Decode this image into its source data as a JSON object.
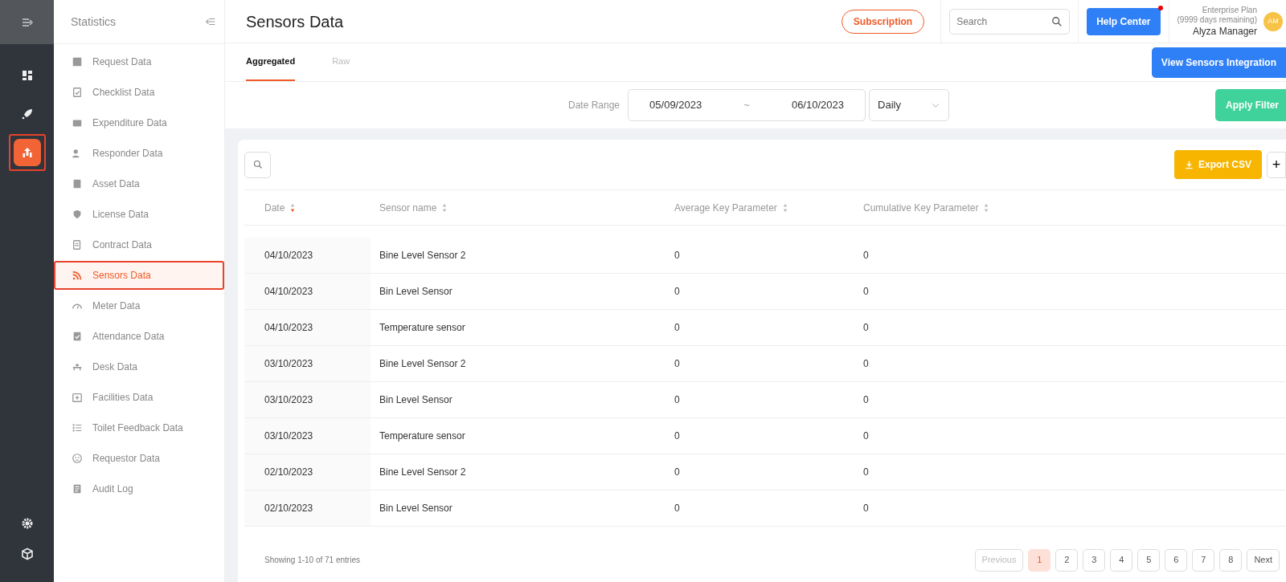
{
  "rail": {
    "items": [
      {
        "kind": "dashboard",
        "selected": false
      },
      {
        "kind": "rocket",
        "selected": false
      },
      {
        "kind": "statistics",
        "selected": true
      }
    ],
    "bottom_items": [
      {
        "kind": "settings"
      },
      {
        "kind": "box"
      }
    ]
  },
  "sidebar": {
    "title": "Statistics",
    "items": [
      {
        "label": "Request Data",
        "selected": false
      },
      {
        "label": "Checklist Data",
        "selected": false
      },
      {
        "label": "Expenditure Data",
        "selected": false
      },
      {
        "label": "Responder Data",
        "selected": false
      },
      {
        "label": "Asset Data",
        "selected": false
      },
      {
        "label": "License Data",
        "selected": false
      },
      {
        "label": "Contract Data",
        "selected": false
      },
      {
        "label": "Sensors Data",
        "selected": true
      },
      {
        "label": "Meter Data",
        "selected": false
      },
      {
        "label": "Attendance Data",
        "selected": false
      },
      {
        "label": "Desk Data",
        "selected": false
      },
      {
        "label": "Facilities Data",
        "selected": false
      },
      {
        "label": "Toilet Feedback Data",
        "selected": false
      },
      {
        "label": "Requestor Data",
        "selected": false
      },
      {
        "label": "Audit Log",
        "selected": false
      }
    ]
  },
  "header": {
    "title": "Sensors Data",
    "subscription": "Subscription",
    "search": {
      "placeholder": "Search"
    },
    "help": {
      "label": "Help Center",
      "notification": true
    },
    "plan": "Enterprise Plan",
    "plan_remaining": "(9999 days remaining)",
    "user": "Alyza Manager",
    "avatar": "AM"
  },
  "tabs": [
    {
      "label": "Aggregated",
      "selected": true
    },
    {
      "label": "Raw",
      "selected": false
    }
  ],
  "integration_button": "View Sensors Integration",
  "filter": {
    "label": "Date Range",
    "start": "05/09/2023",
    "separator": "~",
    "end": "06/10/2023",
    "period": "Daily",
    "apply": "Apply Filter"
  },
  "table": {
    "export": "Export CSV",
    "add": "+",
    "columns": [
      {
        "label": "Date",
        "sorted": true
      },
      {
        "label": "Sensor name",
        "sorted": false
      },
      {
        "label": "Average Key Parameter",
        "sorted": false
      },
      {
        "label": "Cumulative Key Parameter",
        "sorted": false
      }
    ],
    "rows": [
      [
        "04/10/2023",
        "Bine Level Sensor 2",
        "0",
        "0"
      ],
      [
        "04/10/2023",
        "Bin Level Sensor",
        "0",
        "0"
      ],
      [
        "04/10/2023",
        "Temperature sensor",
        "0",
        "0"
      ],
      [
        "03/10/2023",
        "Bine Level Sensor 2",
        "0",
        "0"
      ],
      [
        "03/10/2023",
        "Bin Level Sensor",
        "0",
        "0"
      ],
      [
        "03/10/2023",
        "Temperature sensor",
        "0",
        "0"
      ],
      [
        "02/10/2023",
        "Bine Level Sensor 2",
        "0",
        "0"
      ],
      [
        "02/10/2023",
        "Bin Level Sensor",
        "0",
        "0"
      ]
    ]
  },
  "footer": {
    "info": "Showing 1-10 of 71 entries",
    "previous": {
      "label": "Previous",
      "disabled": true
    },
    "pages": [
      {
        "label": "1",
        "selected": true
      },
      {
        "label": "2",
        "selected": false
      },
      {
        "label": "3",
        "selected": false
      },
      {
        "label": "4",
        "selected": false
      },
      {
        "label": "5",
        "selected": false
      },
      {
        "label": "6",
        "selected": false
      },
      {
        "label": "7",
        "selected": false
      },
      {
        "label": "8",
        "selected": false
      }
    ],
    "next": {
      "label": "Next",
      "disabled": false
    }
  }
}
